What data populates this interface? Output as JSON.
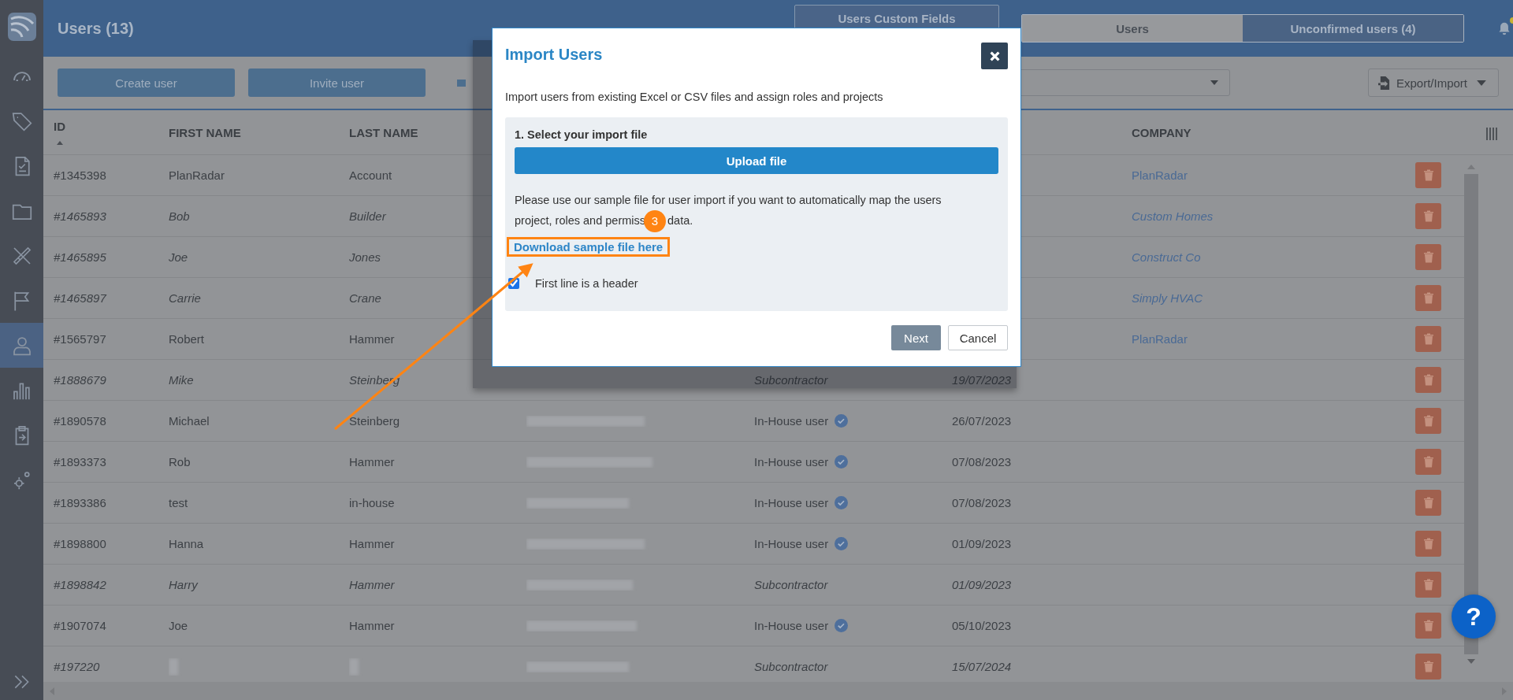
{
  "sidebar": {
    "items": [
      {
        "selected": false
      },
      {
        "selected": false
      },
      {
        "selected": false
      },
      {
        "selected": false
      },
      {
        "selected": false
      },
      {
        "selected": false
      },
      {
        "selected": true
      },
      {
        "selected": false
      },
      {
        "selected": false
      },
      {
        "selected": false
      }
    ]
  },
  "header": {
    "title": "Users (13)",
    "custom_fields_button": "Users Custom Fields",
    "tabs": [
      {
        "label": "Users",
        "selected": true
      },
      {
        "label": "Unconfirmed users (4)",
        "selected": false
      }
    ],
    "notification_dot": true
  },
  "toolbar": {
    "create_button": "Create user",
    "invite_button": "Invite user",
    "export_button": "Export/Import"
  },
  "table": {
    "columns": {
      "id": "ID",
      "first_name": "FIRST NAME",
      "last_name": "LAST NAME",
      "company": "COMPANY"
    },
    "rows": [
      {
        "kind": "in_house",
        "id": "#1345398",
        "first_name": "PlanRadar",
        "last_name": "Account",
        "company": "PlanRadar"
      },
      {
        "kind": "subcontractor",
        "id": "#1465893",
        "first_name": "Bob",
        "last_name": "Builder",
        "company": "Custom Homes"
      },
      {
        "kind": "subcontractor",
        "id": "#1465895",
        "first_name": "Joe",
        "last_name": "Jones",
        "company": "Construct Co"
      },
      {
        "kind": "subcontractor",
        "id": "#1465897",
        "first_name": "Carrie",
        "last_name": "Crane",
        "company": "Simply HVAC"
      },
      {
        "kind": "in_house",
        "id": "#1565797",
        "first_name": "Robert",
        "last_name": "Hammer",
        "company": "PlanRadar"
      },
      {
        "kind": "subcontractor",
        "id": "#1888679",
        "first_name": "Mike",
        "last_name": "Steinberg",
        "role": "Subcontractor",
        "date": "19/07/2023"
      },
      {
        "kind": "in_house",
        "id": "#1890578",
        "first_name": "Michael",
        "last_name": "Steinberg",
        "email_blurred": true,
        "role": "In-House user",
        "verified": true,
        "date": "26/07/2023"
      },
      {
        "kind": "in_house",
        "id": "#1893373",
        "first_name": "Rob",
        "last_name": "Hammer",
        "email_blurred": true,
        "role": "In-House user",
        "verified": true,
        "date": "07/08/2023"
      },
      {
        "kind": "in_house",
        "id": "#1893386",
        "first_name": "test",
        "last_name": "in-house",
        "email_blurred": true,
        "role": "In-House user",
        "verified": true,
        "date": "07/08/2023"
      },
      {
        "kind": "in_house",
        "id": "#1898800",
        "first_name": "Hanna",
        "last_name": "Hammer",
        "email_blurred": true,
        "role": "In-House user",
        "verified": true,
        "date": "01/09/2023"
      },
      {
        "kind": "subcontractor",
        "id": "#1898842",
        "first_name": "Harry",
        "last_name": "Hammer",
        "email_blurred": true,
        "role": "Subcontractor",
        "date": "01/09/2023"
      },
      {
        "kind": "in_house",
        "id": "#1907074",
        "first_name": "Joe",
        "last_name": "Hammer",
        "email_blurred": true,
        "role": "In-House user",
        "verified": true,
        "date": "05/10/2023"
      },
      {
        "kind": "subcontractor",
        "id": "#197220",
        "names_blurred": true,
        "email_blurred": true,
        "role": "Subcontractor",
        "date": "15/07/2024"
      }
    ]
  },
  "modal": {
    "title": "Import Users",
    "description": "Import users from existing Excel or CSV files and assign roles and projects",
    "step_title": "1. Select your import file",
    "upload_button": "Upload file",
    "hint": "Please use our sample file for user import if you want to automatically map the users",
    "hint_2": "project, roles and permiss",
    "hint_end": "data.",
    "link": "Download sample file here",
    "checkbox": {
      "label": "First line is a header",
      "checked": true
    },
    "next_button": "Next",
    "cancel_button": "Cancel"
  },
  "annotation": {
    "step": "3"
  },
  "help_button": "?"
}
